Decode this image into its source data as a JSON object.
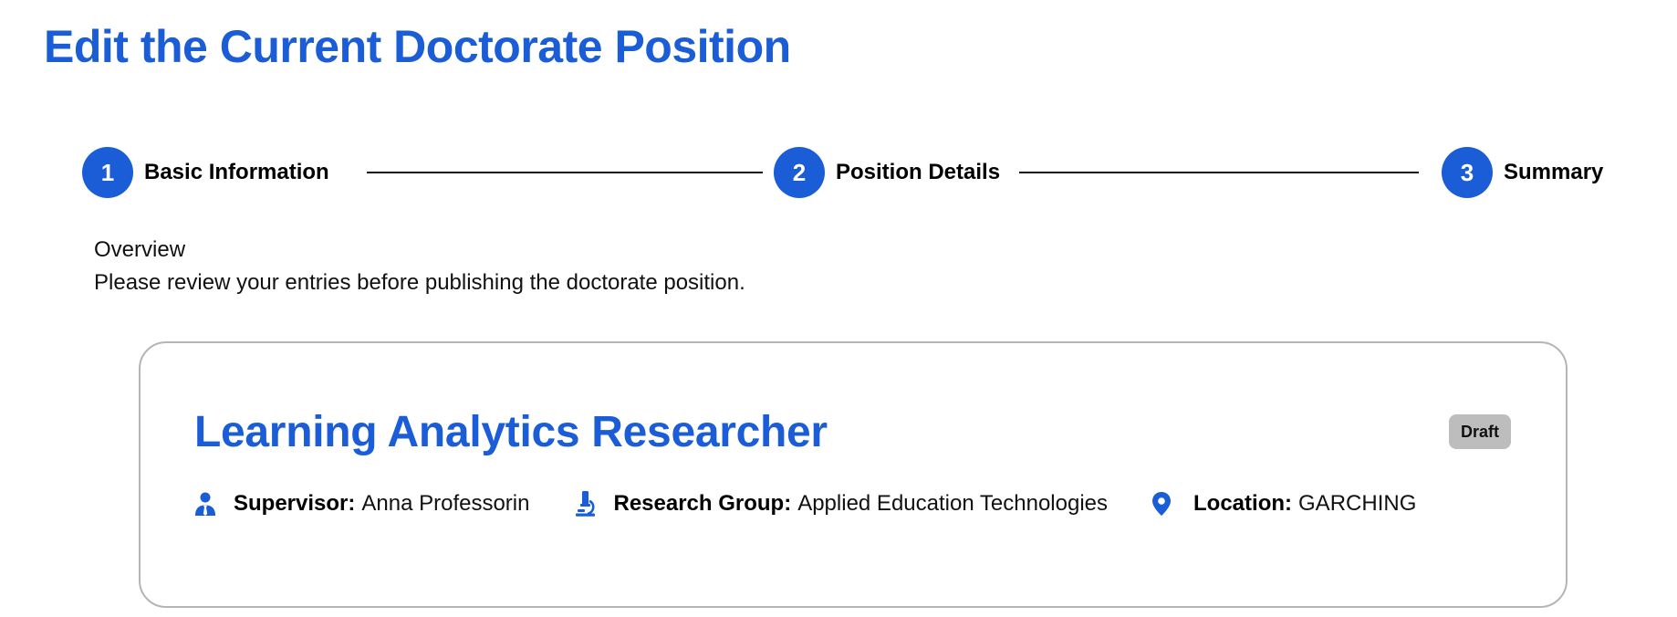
{
  "page": {
    "title": "Edit the Current Doctorate Position"
  },
  "stepper": {
    "steps": [
      {
        "number": "1",
        "label": "Basic Information"
      },
      {
        "number": "2",
        "label": "Position Details"
      },
      {
        "number": "3",
        "label": "Summary"
      }
    ]
  },
  "overview": {
    "heading": "Overview",
    "description": "Please review your entries before publishing the doctorate position."
  },
  "card": {
    "title": "Learning Analytics Researcher",
    "status": "Draft",
    "supervisor": {
      "label": "Supervisor:",
      "value": "Anna Professorin",
      "icon": "person-icon"
    },
    "research_group": {
      "label": "Research Group:",
      "value": "Applied Education Technologies",
      "icon": "microscope-icon"
    },
    "location": {
      "label": "Location:",
      "value": "GARCHING",
      "icon": "location-pin-icon"
    }
  },
  "colors": {
    "accent": "#1a5dd6",
    "badge_bg": "#bdbdbd",
    "card_border": "#b5b5b5"
  }
}
